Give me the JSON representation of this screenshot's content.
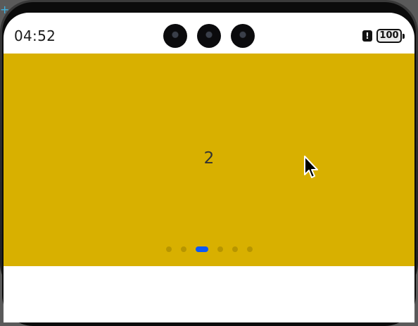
{
  "status_bar": {
    "time": "04:52",
    "alert_glyph": "!",
    "battery_level": "100",
    "icons": [
      "camera-lens",
      "camera-lens",
      "camera-lens",
      "alert-icon",
      "battery-icon"
    ]
  },
  "carousel": {
    "current_slide_label": "2",
    "background_color": "#d8b000",
    "page_count": 6,
    "active_page_index": 2,
    "active_dot_color": "#0a59f7"
  },
  "cursor_icon": "mouse-pointer-icon"
}
